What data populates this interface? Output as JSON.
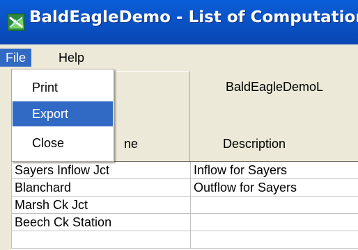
{
  "window": {
    "title": "BaldEagleDemo - List of Computation",
    "icon": "hec-hms-app-icon"
  },
  "menubar": {
    "items": [
      "File",
      "Help"
    ],
    "active": "File"
  },
  "file_menu": {
    "items": [
      "Print",
      "Export",
      "Close"
    ],
    "highlighted": "Export"
  },
  "table": {
    "model_header": "BaldEagleDemoL",
    "name_header_visible": "ne",
    "description_header": "Description",
    "rows": [
      {
        "name": "Sayers Inflow Jct",
        "description": "Inflow for Sayers"
      },
      {
        "name": "Blanchard",
        "description": "Outflow for Sayers"
      },
      {
        "name": "Marsh Ck Jct",
        "description": ""
      },
      {
        "name": "Beech Ck Station",
        "description": ""
      }
    ]
  },
  "colors": {
    "titlebar": "#0a52c6",
    "highlight": "#316ac5",
    "chrome": "#ece9d8"
  }
}
